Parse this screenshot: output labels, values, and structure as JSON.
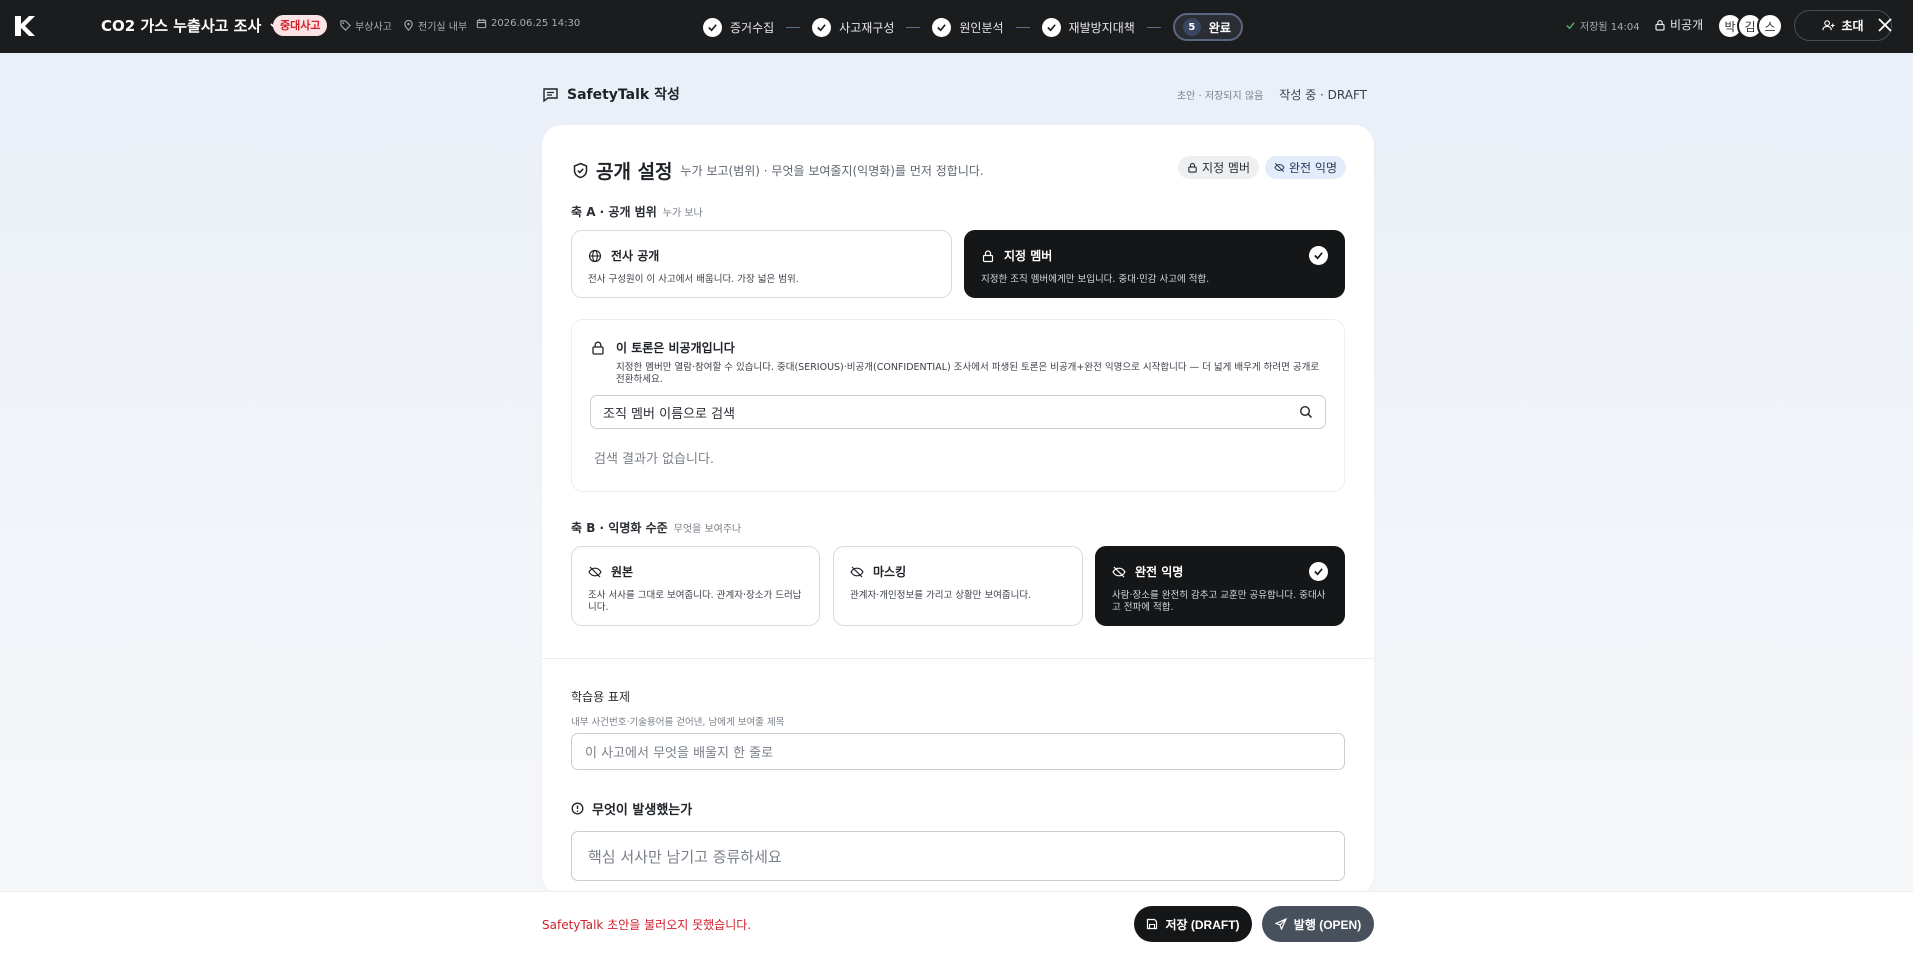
{
  "header": {
    "title": "CO2 가스 누출사고 조사",
    "severity_badge": "중대사고",
    "meta": [
      {
        "icon": "tag-icon",
        "text": "부상사고"
      },
      {
        "icon": "location-icon",
        "text": "전기실 내부"
      },
      {
        "icon": "calendar-icon",
        "text": "2026.06.25 14:30"
      }
    ],
    "steps": [
      {
        "label": "증거수집",
        "state": "done"
      },
      {
        "label": "사고재구성",
        "state": "done"
      },
      {
        "label": "원인분석",
        "state": "done"
      },
      {
        "label": "재발방지대책",
        "state": "done"
      },
      {
        "label": "완료",
        "number": "5",
        "state": "active"
      }
    ],
    "saved_text": "저장됨 14:04",
    "visibility": "비공개",
    "avatars": [
      "박",
      "김",
      "스"
    ],
    "invite_label": "초대"
  },
  "page": {
    "title": "SafetyTalk 작성",
    "draft_note": "초안 · 저장되지 않음",
    "status": "작성 중 · DRAFT"
  },
  "visibility_section": {
    "title": "공개 설정",
    "description": "누가 보고(범위) · 무엇을 보여줄지(익명화)를 먼저 정합니다.",
    "chip_scope": "지정 멤버",
    "chip_anon": "완전 익명",
    "axis_a": {
      "label": "축 A · 공개 범위",
      "sub": "누가 보나"
    },
    "scope_options": [
      {
        "title": "전사 공개",
        "desc": "전사 구성원이 이 사고에서 배웁니다. 가장 넓은 범위."
      },
      {
        "title": "지정 멤버",
        "desc": "지정한 조직 멤버에게만 보입니다. 중대·민감 사고에 적합."
      }
    ],
    "private_box": {
      "title": "이 토론은 비공개입니다",
      "desc": "지정한 멤버만 열람·참여할 수 있습니다. 중대(SERIOUS)·비공개(CONFIDENTIAL) 조사에서 파생된 토론은 비공개+완전 익명으로 시작합니다 — 더 넓게 배우게 하려면 공개로 전환하세요.",
      "search_placeholder": "조직 멤버 이름으로 검색",
      "empty_text": "검색 결과가 없습니다."
    },
    "axis_b": {
      "label": "축 B · 익명화 수준",
      "sub": "무엇을 보여주나"
    },
    "anon_options": [
      {
        "title": "원본",
        "desc": "조사 서사를 그대로 보여줍니다. 관계자·장소가 드러납니다."
      },
      {
        "title": "마스킹",
        "desc": "관계자·개인정보를 가리고 상황만 보여줍니다."
      },
      {
        "title": "완전 익명",
        "desc": "사람·장소를 완전히 감추고 교훈만 공유합니다. 중대사고 전파에 적합."
      }
    ]
  },
  "form": {
    "study_title_label": "학습용 표제",
    "study_title_sub": "내부 사건번호·기술용어를 걷어낸, 남에게 보여줄 제목",
    "study_title_placeholder": "이 사고에서 무엇을 배울지 한 줄로",
    "what_label": "무엇이 발생했는가",
    "what_placeholder": "핵심 서사만 남기고 증류하세요"
  },
  "footer": {
    "error": "SafetyTalk 초안을 불러오지 못했습니다.",
    "save_label": "저장 (DRAFT)",
    "publish_label": "발행 (OPEN)"
  }
}
